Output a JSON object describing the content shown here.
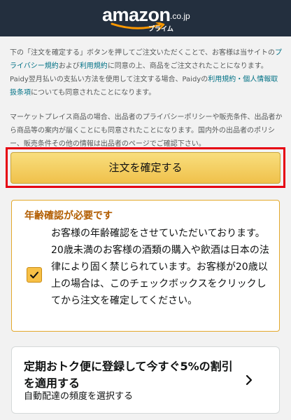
{
  "header": {
    "logo_text": "amazon",
    "logo_tld": ".co.jp",
    "logo_sub": "プライム"
  },
  "legal": {
    "p1_a": "下の「注文を確定する」ボタンを押してご注文いただくことで、お客様は当サイトの",
    "link_privacy": "プライバシー規約",
    "p1_b": "および",
    "link_terms": "利用規約",
    "p1_c": "に同意の上、商品をご注文されたことになります。Paidy翌月払いの支払い方法を使用して注文する場合、Paidyの",
    "link_paidy": "利用規約・個人情報取扱条項",
    "p1_d": "についても同意されたことになります。",
    "p2": "マーケットプレイス商品の場合、出品者のプライバシーポリシーや販売条件、出品者から商品等の案内が届くことにも同意されたことになります。国内外の出品者のポリシー、販売条件その他の情報は出品者のページでご確認下さい。"
  },
  "place_order": {
    "label": "注文を確定する"
  },
  "age_verification": {
    "title": "年齢確認が必要です",
    "checked": true,
    "text": "お客様の年齢確認をさせていただいております。20歳未満のお客様の酒類の購入や飲酒は日本の法律により固く禁じられています。お客様が20歳以上の場合は、このチェックボックスをクリックしてから注文を確定してください。"
  },
  "subscription": {
    "title": "定期おトク便に登録して今すぐ5%の割引を適用する",
    "subtitle": "自動配達の頻度を選択する"
  },
  "colors": {
    "header_bg": "#232f3e",
    "link": "#007185",
    "button": "#f0c14b",
    "highlight": "#e60012",
    "age_title": "#b25d00",
    "checkbox": "#f7c046"
  },
  "icons": {
    "smile": "amazon-smile-arrow",
    "check": "checkmark-icon",
    "chevron": "chevron-right-icon"
  }
}
